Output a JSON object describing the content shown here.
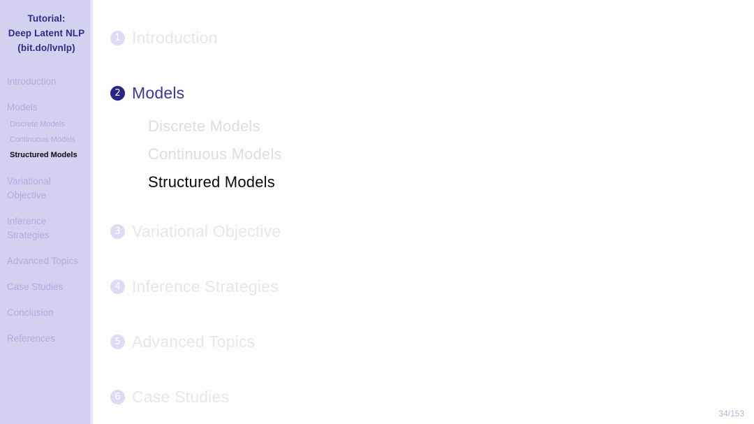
{
  "sidebar": {
    "title_lines": [
      "Tutorial:",
      "Deep Latent NLP",
      "(bit.do/lvnlp)"
    ],
    "items": [
      {
        "label": "Introduction",
        "state": "inactive"
      },
      {
        "label": "Models",
        "state": "inactive"
      },
      {
        "label": "Variational Objective",
        "state": "inactive"
      },
      {
        "label": "Inference Strategies",
        "state": "inactive"
      },
      {
        "label": "Advanced Topics",
        "state": "inactive"
      },
      {
        "label": "Case Studies",
        "state": "inactive"
      },
      {
        "label": "Conclusion",
        "state": "inactive"
      },
      {
        "label": "References",
        "state": "inactive"
      }
    ],
    "subitems": [
      {
        "label": "Discrete Models",
        "state": "inactive"
      },
      {
        "label": "Continuous Models",
        "state": "inactive"
      },
      {
        "label": "Structured Models",
        "state": "current"
      }
    ]
  },
  "toc": {
    "entries": [
      {
        "number": "1",
        "label": "Introduction",
        "state": "inactive"
      },
      {
        "number": "2",
        "label": "Models",
        "state": "active"
      },
      {
        "number": "3",
        "label": "Variational Objective",
        "state": "inactive"
      },
      {
        "number": "4",
        "label": "Inference Strategies",
        "state": "inactive"
      },
      {
        "number": "5",
        "label": "Advanced Topics",
        "state": "inactive"
      },
      {
        "number": "6",
        "label": "Case Studies",
        "state": "inactive"
      }
    ],
    "subsections": [
      {
        "label": "Discrete Models",
        "state": "inactive"
      },
      {
        "label": "Continuous Models",
        "state": "inactive"
      },
      {
        "label": "Structured Models",
        "state": "current"
      }
    ]
  },
  "footer": {
    "page_indicator": "34/153"
  },
  "colors": {
    "sidebar_background": "#d4d1f0",
    "sidebar_text": "#b0abe0",
    "sidebar_title": "#2f2a86",
    "accent_active": "#2a2487",
    "content_background": "#fdfdfc",
    "faded_text": "#e7e6ef",
    "current_text": "#0a0a0a"
  }
}
